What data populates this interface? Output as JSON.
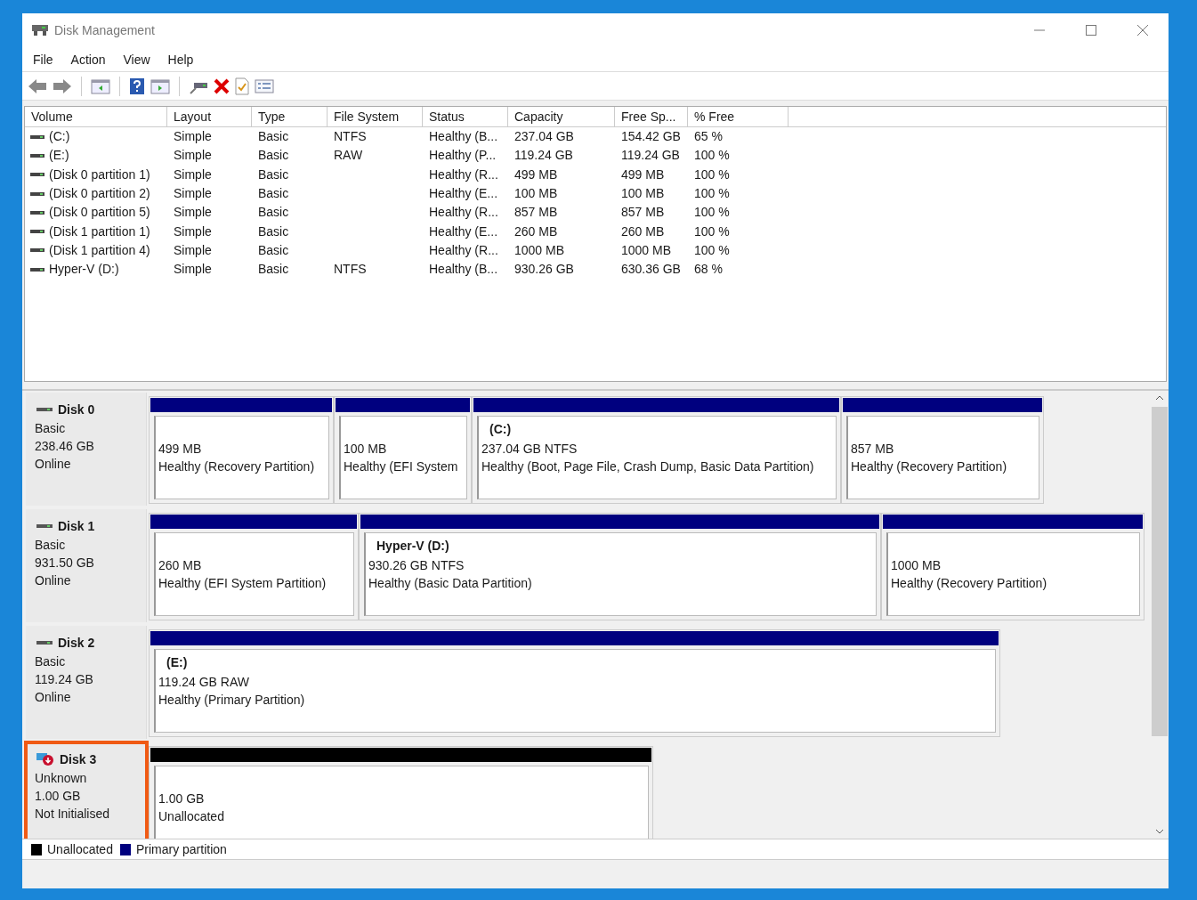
{
  "window": {
    "title": "Disk Management"
  },
  "menu": [
    "File",
    "Action",
    "View",
    "Help"
  ],
  "table": {
    "columns": [
      "Volume",
      "Layout",
      "Type",
      "File System",
      "Status",
      "Capacity",
      "Free Sp...",
      "% Free"
    ],
    "rows": [
      {
        "cells": [
          "(C:)",
          "Simple",
          "Basic",
          "NTFS",
          "Healthy (B...",
          "237.04 GB",
          "154.42 GB",
          "65 %"
        ]
      },
      {
        "cells": [
          "(E:)",
          "Simple",
          "Basic",
          "RAW",
          "Healthy (P...",
          "119.24 GB",
          "119.24 GB",
          "100 %"
        ]
      },
      {
        "cells": [
          "(Disk 0 partition 1)",
          "Simple",
          "Basic",
          "",
          "Healthy (R...",
          "499 MB",
          "499 MB",
          "100 %"
        ]
      },
      {
        "cells": [
          "(Disk 0 partition 2)",
          "Simple",
          "Basic",
          "",
          "Healthy (E...",
          "100 MB",
          "100 MB",
          "100 %"
        ]
      },
      {
        "cells": [
          "(Disk 0 partition 5)",
          "Simple",
          "Basic",
          "",
          "Healthy (R...",
          "857 MB",
          "857 MB",
          "100 %"
        ]
      },
      {
        "cells": [
          "(Disk 1 partition 1)",
          "Simple",
          "Basic",
          "",
          "Healthy (E...",
          "260 MB",
          "260 MB",
          "100 %"
        ]
      },
      {
        "cells": [
          "(Disk 1 partition 4)",
          "Simple",
          "Basic",
          "",
          "Healthy (R...",
          "1000 MB",
          "1000 MB",
          "100 %"
        ]
      },
      {
        "cells": [
          "Hyper-V (D:)",
          "Simple",
          "Basic",
          "NTFS",
          "Healthy (B...",
          "930.26 GB",
          "630.36 GB",
          "68 %"
        ]
      }
    ]
  },
  "disks": [
    {
      "name": "Disk 0",
      "kind": "online",
      "highlighted": false,
      "lines": [
        "Basic",
        "238.46 GB",
        "Online"
      ],
      "partitions": [
        {
          "kind": "primary",
          "lines": [
            "499 MB",
            "Healthy (Recovery Partition)"
          ]
        },
        {
          "kind": "primary",
          "lines": [
            "100 MB",
            "Healthy (EFI System"
          ]
        },
        {
          "kind": "primary",
          "title": "(C:)",
          "lines": [
            "237.04 GB NTFS",
            "Healthy (Boot, Page File, Crash Dump, Basic Data Partition)"
          ]
        },
        {
          "kind": "primary",
          "lines": [
            "857 MB",
            "Healthy (Recovery Partition)"
          ]
        }
      ]
    },
    {
      "name": "Disk 1",
      "kind": "online",
      "highlighted": false,
      "lines": [
        "Basic",
        "931.50 GB",
        "Online"
      ],
      "partitions": [
        {
          "kind": "primary",
          "lines": [
            "260 MB",
            "Healthy (EFI System Partition)"
          ]
        },
        {
          "kind": "primary",
          "title": "Hyper-V  (D:)",
          "lines": [
            "930.26 GB NTFS",
            "Healthy (Basic Data Partition)"
          ]
        },
        {
          "kind": "primary",
          "lines": [
            "1000 MB",
            "Healthy (Recovery Partition)"
          ]
        }
      ]
    },
    {
      "name": "Disk 2",
      "kind": "online",
      "highlighted": false,
      "lines": [
        "Basic",
        "119.24 GB",
        "Online"
      ],
      "partitions": [
        {
          "kind": "primary",
          "title": "(E:)",
          "lines": [
            "119.24 GB RAW",
            "Healthy (Primary Partition)"
          ]
        }
      ]
    },
    {
      "name": "Disk 3",
      "kind": "unknown",
      "highlighted": true,
      "lines": [
        "Unknown",
        "1.00 GB",
        "Not Initialised"
      ],
      "partitions": [
        {
          "kind": "unallocated",
          "lines": [
            "1.00 GB",
            "Unallocated"
          ]
        }
      ]
    }
  ],
  "legend": [
    {
      "kind": "unallocated",
      "label": "Unallocated"
    },
    {
      "kind": "primary",
      "label": "Primary partition"
    }
  ]
}
